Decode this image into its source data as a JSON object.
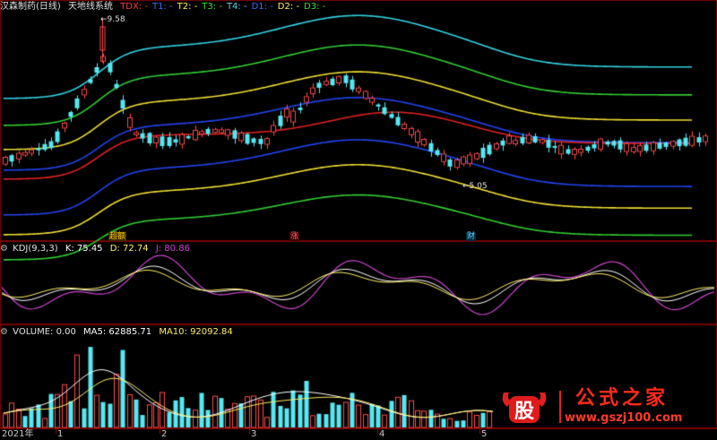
{
  "main_panel": {
    "stock_title": "汉森制药(日线)",
    "indicator_name": "天地线系统",
    "indicators": [
      {
        "label": "TDX: -",
        "color": "#ff3b3b"
      },
      {
        "label": "T1: -",
        "color": "#3b6bff"
      },
      {
        "label": "T2: -",
        "color": "#ffee55"
      },
      {
        "label": "T3: -",
        "color": "#33dd33"
      },
      {
        "label": "T4: -",
        "color": "#4fd8e8"
      },
      {
        "label": "D1: -",
        "color": "#3b6bff"
      },
      {
        "label": "D2: -",
        "color": "#ffee55"
      },
      {
        "label": "D3: -",
        "color": "#33dd33"
      }
    ],
    "high_marker": "9.58",
    "low_marker": "5.05",
    "event_tags": [
      "超额",
      "涨",
      "财"
    ]
  },
  "kdj_panel": {
    "label": "KDJ(9,3,3)",
    "k": "K: 75.45",
    "d": "D: 72.74",
    "j": "J: 80.86",
    "colors": {
      "k": "#ffffff",
      "d": "#ffee66",
      "j": "#cc44cc"
    }
  },
  "volume_panel": {
    "label": "VOLUME: 0.00",
    "ma5": "MA5: 62885.71",
    "ma10": "MA10: 92092.84",
    "colors": {
      "ma5": "#ffffff",
      "ma10": "#ffee66"
    }
  },
  "date_axis": {
    "year": "2021年",
    "months": [
      "1",
      "2",
      "3",
      "4",
      "5"
    ]
  },
  "colors": {
    "up": "#ff4b4b",
    "down": "#55e8f2",
    "mid_line": "#dd2222",
    "t1_line": "#2244ee",
    "t2_line": "#eedd33",
    "t3_line": "#33cc33",
    "t4_line": "#33d3e3",
    "panel_border": "#7a0000"
  },
  "watermark": {
    "title": "公式之家",
    "url": "www.gszj100.com",
    "logo_char": "股"
  }
}
